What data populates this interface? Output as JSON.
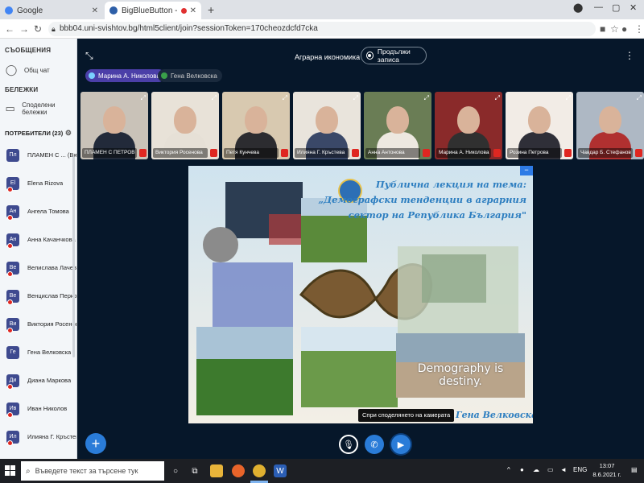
{
  "browser": {
    "tabs": [
      {
        "title": "Google",
        "favicon_color": "#4285f4"
      },
      {
        "title": "BigBlueButton - Аграрна ико",
        "favicon_color": "#2e5fa8"
      }
    ],
    "new_tab": "+",
    "url": "bbb04.uni-svishtov.bg/html5client/join?sessionToken=170cheozdcfd7cka"
  },
  "sidebar": {
    "messages_header": "СЪОБЩЕНИЯ",
    "public_chat": "Общ чат",
    "notes_header": "БЕЛЕЖКИ",
    "shared_notes": "Споделени бележки",
    "users_header": "ПОТРЕБИТЕЛИ (23)",
    "users": [
      {
        "initials": "Пл",
        "name": "ПЛАМЕН С ...  (Вие)",
        "mic_muted": false
      },
      {
        "initials": "El",
        "name": "Elena Rizova",
        "mic_muted": true
      },
      {
        "initials": "Ан",
        "name": "Ангела Томова",
        "mic_muted": true
      },
      {
        "initials": "Ан",
        "name": "Анна Качанчкова",
        "mic_muted": true
      },
      {
        "initials": "Ве",
        "name": "Велислава Лачева",
        "mic_muted": true
      },
      {
        "initials": "Ве",
        "name": "Венцислав Перков",
        "mic_muted": true
      },
      {
        "initials": "Ви",
        "name": "Виктория Росенова",
        "mic_muted": true
      },
      {
        "initials": "Ге",
        "name": "Гена Велковска",
        "mic_muted": false
      },
      {
        "initials": "Ди",
        "name": "Диана Маркова",
        "mic_muted": true
      },
      {
        "initials": "Ив",
        "name": "Иван Николов",
        "mic_muted": true
      },
      {
        "initials": "Ил",
        "name": "Илияна Г. Кръстева",
        "mic_muted": true
      }
    ]
  },
  "main": {
    "meeting_title": "Аграрна икономика",
    "record_label": "Продължи записа",
    "talking": [
      {
        "name": "Марина А. Николова",
        "dot_color": "#7ad0ff"
      },
      {
        "name": "Гена Велковска",
        "dot_color": "#3aa04a"
      }
    ],
    "cameras": [
      {
        "name": "ПЛАМЕН С ПЕТРОВ",
        "bg": "#c9c2b8",
        "shirt": "#222a3a"
      },
      {
        "name": "Виктория Росенова",
        "bg": "#e8e2d8",
        "shirt": "#e6e0d6"
      },
      {
        "name": "Петя Кунчева",
        "bg": "#d8c9b0",
        "shirt": "#2c2c30"
      },
      {
        "name": "Илияна Г. Кръстева",
        "bg": "#e9e4dc",
        "shirt": "#3a4868"
      },
      {
        "name": "Анна Антонова",
        "bg": "#6a7d55",
        "shirt": "#ede8e0"
      },
      {
        "name": "Марина А. Николова",
        "bg": "#8a2a2a",
        "shirt": "#303030"
      },
      {
        "name": "Розина Петрова",
        "bg": "#f2ece6",
        "shirt": "#2f2f38"
      },
      {
        "name": "Чавдар Б. Стефанов",
        "bg": "#aeb8c4",
        "shirt": "#b03030"
      }
    ],
    "slide": {
      "title": "Публична лекция на тема: „Демографски тенденции в аграрния сектор на Република България\"",
      "quote": "Demography is destiny.",
      "author": "... Проф. д-р Гена Велковска"
    },
    "tooltip": "Спри споделянето на камерата"
  },
  "taskbar": {
    "search_placeholder": "Въведете текст за търсене тук",
    "lang": "ENG",
    "time": "13:07",
    "date": "8.6.2021 г."
  }
}
